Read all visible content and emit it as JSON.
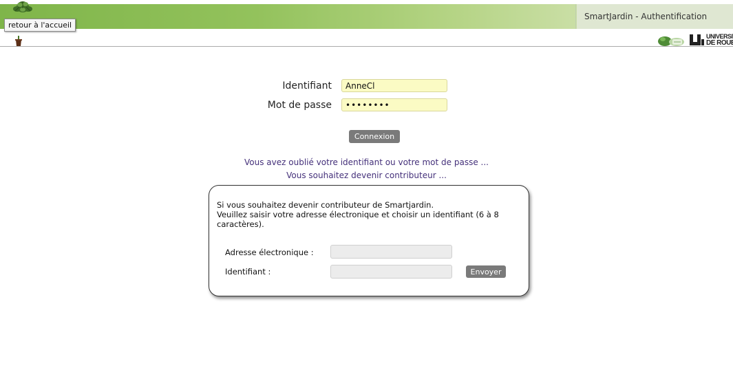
{
  "header": {
    "app_title": "SmartJardin - Authentification",
    "home_tooltip": "retour à l'accueil",
    "univ_logo_line1": "UNIVERSITÉ",
    "univ_logo_line2": "DE ROUEN",
    "colors": {
      "banner_start": "#7fb54a",
      "banner_end": "#d9e6c2",
      "title_bg": "#dfe7d2"
    }
  },
  "login": {
    "id_label": "Identifiant",
    "id_value": "AnneCl",
    "password_label": "Mot de passe",
    "password_value": "••••••••",
    "submit_label": "Connexion",
    "field_bg_color": "#fbfbc4"
  },
  "links": {
    "forgot": "Vous avez oublié votre identifiant ou votre mot de passe ...",
    "contribute": "Vous souhaitez devenir contributeur ...",
    "color": "#44307a"
  },
  "contributor_form": {
    "intro_line1": "Si vous souhaitez devenir contributeur de Smartjardin.",
    "intro_line2": "Veuillez saisir votre adresse électronique et choisir un identifiant (6 à 8",
    "intro_line3": "caractères).",
    "email_label": "Adresse électronique :",
    "email_value": "",
    "id_label": "Identifiant :",
    "id_value": "",
    "submit_label": "Envoyer"
  },
  "icons": {
    "home_logo": "potted-plant-icon",
    "pot": "plant-pot-icon",
    "partner_logo": "partner-logo-icon",
    "university_logo": "university-logo-icon"
  }
}
